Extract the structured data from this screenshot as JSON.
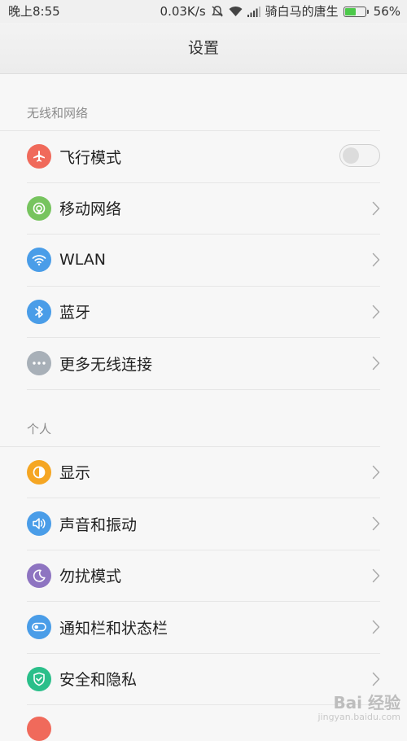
{
  "status_bar": {
    "time": "晚上8:55",
    "speed": "0.03K/s",
    "carrier": "骑白马的唐生",
    "battery": "56%",
    "battery_level": 0.56,
    "icons": [
      "mute-icon",
      "wifi-icon",
      "signal-icon",
      "battery-icon"
    ]
  },
  "header": {
    "title": "设置"
  },
  "sections": [
    {
      "title": "无线和网络",
      "items": [
        {
          "label": "飞行模式",
          "icon": "airplane-icon",
          "icon_color": "#f06a5b",
          "control": "toggle",
          "toggle_on": false
        },
        {
          "label": "移动网络",
          "icon": "mobile-network-icon",
          "icon_color": "#77c45f",
          "control": "chevron"
        },
        {
          "label": "WLAN",
          "icon": "wifi-icon",
          "icon_color": "#4a9de8",
          "control": "chevron"
        },
        {
          "label": "蓝牙",
          "icon": "bluetooth-icon",
          "icon_color": "#4a9de8",
          "control": "chevron"
        },
        {
          "label": "更多无线连接",
          "icon": "more-icon",
          "icon_color": "#a8b0b8",
          "control": "chevron"
        }
      ]
    },
    {
      "title": "个人",
      "items": [
        {
          "label": "显示",
          "icon": "display-icon",
          "icon_color": "#f5a623",
          "control": "chevron"
        },
        {
          "label": "声音和振动",
          "icon": "sound-icon",
          "icon_color": "#4a9de8",
          "control": "chevron"
        },
        {
          "label": "勿扰模式",
          "icon": "moon-icon",
          "icon_color": "#8e74c1",
          "control": "chevron"
        },
        {
          "label": "通知栏和状态栏",
          "icon": "notification-bar-icon",
          "icon_color": "#4a9de8",
          "control": "chevron"
        },
        {
          "label": "安全和隐私",
          "icon": "shield-icon",
          "icon_color": "#2bbf8a",
          "control": "chevron"
        }
      ]
    }
  ],
  "watermark": {
    "main": "Bai 经验",
    "sub": "jingyan.baidu.com"
  }
}
